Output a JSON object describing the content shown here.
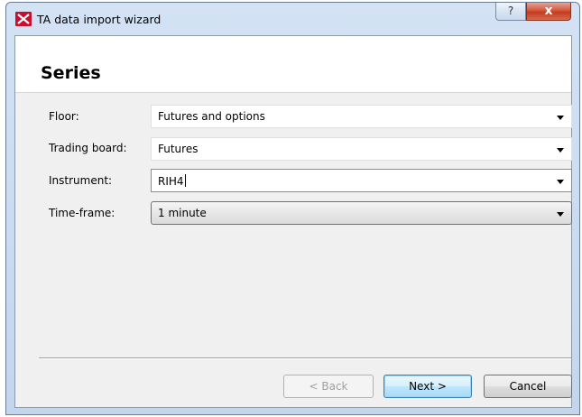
{
  "window": {
    "title": "TA data import wizard",
    "help_glyph": "?",
    "close_glyph": "x",
    "app_icon": "app-logo-icon"
  },
  "page": {
    "title": "Series"
  },
  "form": {
    "fields": [
      {
        "label": "Floor:",
        "value": "Futures and options"
      },
      {
        "label": "Trading board:",
        "value": "Futures"
      },
      {
        "label": "Instrument:",
        "value": "RIH4"
      },
      {
        "label": "Time-frame:",
        "value": "1 minute"
      }
    ]
  },
  "buttons": {
    "back": "< Back",
    "next": "Next >",
    "cancel": "Cancel"
  },
  "colors": {
    "app_icon": "#c8102e",
    "close_button": "#c43b1f",
    "title_bar": "#c3d6ec"
  }
}
